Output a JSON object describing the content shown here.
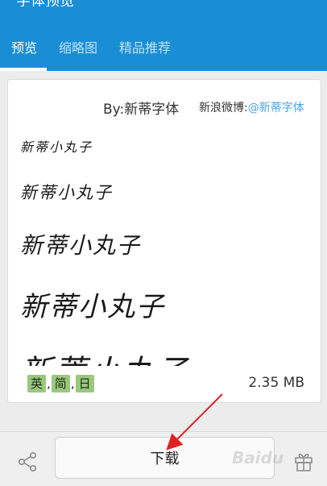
{
  "header": {
    "title": "字体预览",
    "tabs": [
      {
        "label": "预览",
        "active": true
      },
      {
        "label": "缩略图",
        "active": false
      },
      {
        "label": "精品推荐",
        "active": false
      }
    ]
  },
  "preview": {
    "author": "By:新蒂字体",
    "weibo_label": "新浪微博:",
    "weibo_handle": "@新蒂字体",
    "samples": [
      "新蒂小丸子",
      "新蒂小丸子",
      "新蒂小丸子",
      "新蒂小丸子",
      "新蒂小丸子"
    ],
    "languages": [
      "英",
      "简",
      "日"
    ],
    "separator": ",",
    "file_size": "2.35 MB"
  },
  "bottom_bar": {
    "download_label": "下载",
    "share_icon": "share-icon",
    "gift_icon": "gift-icon"
  },
  "watermark": "Baidu",
  "colors": {
    "header": "#1a8ed4",
    "tab_underline": "#ffffff",
    "tag_bg": "#9bc77e",
    "arrow": "#e02020",
    "link": "#4aa3df"
  }
}
